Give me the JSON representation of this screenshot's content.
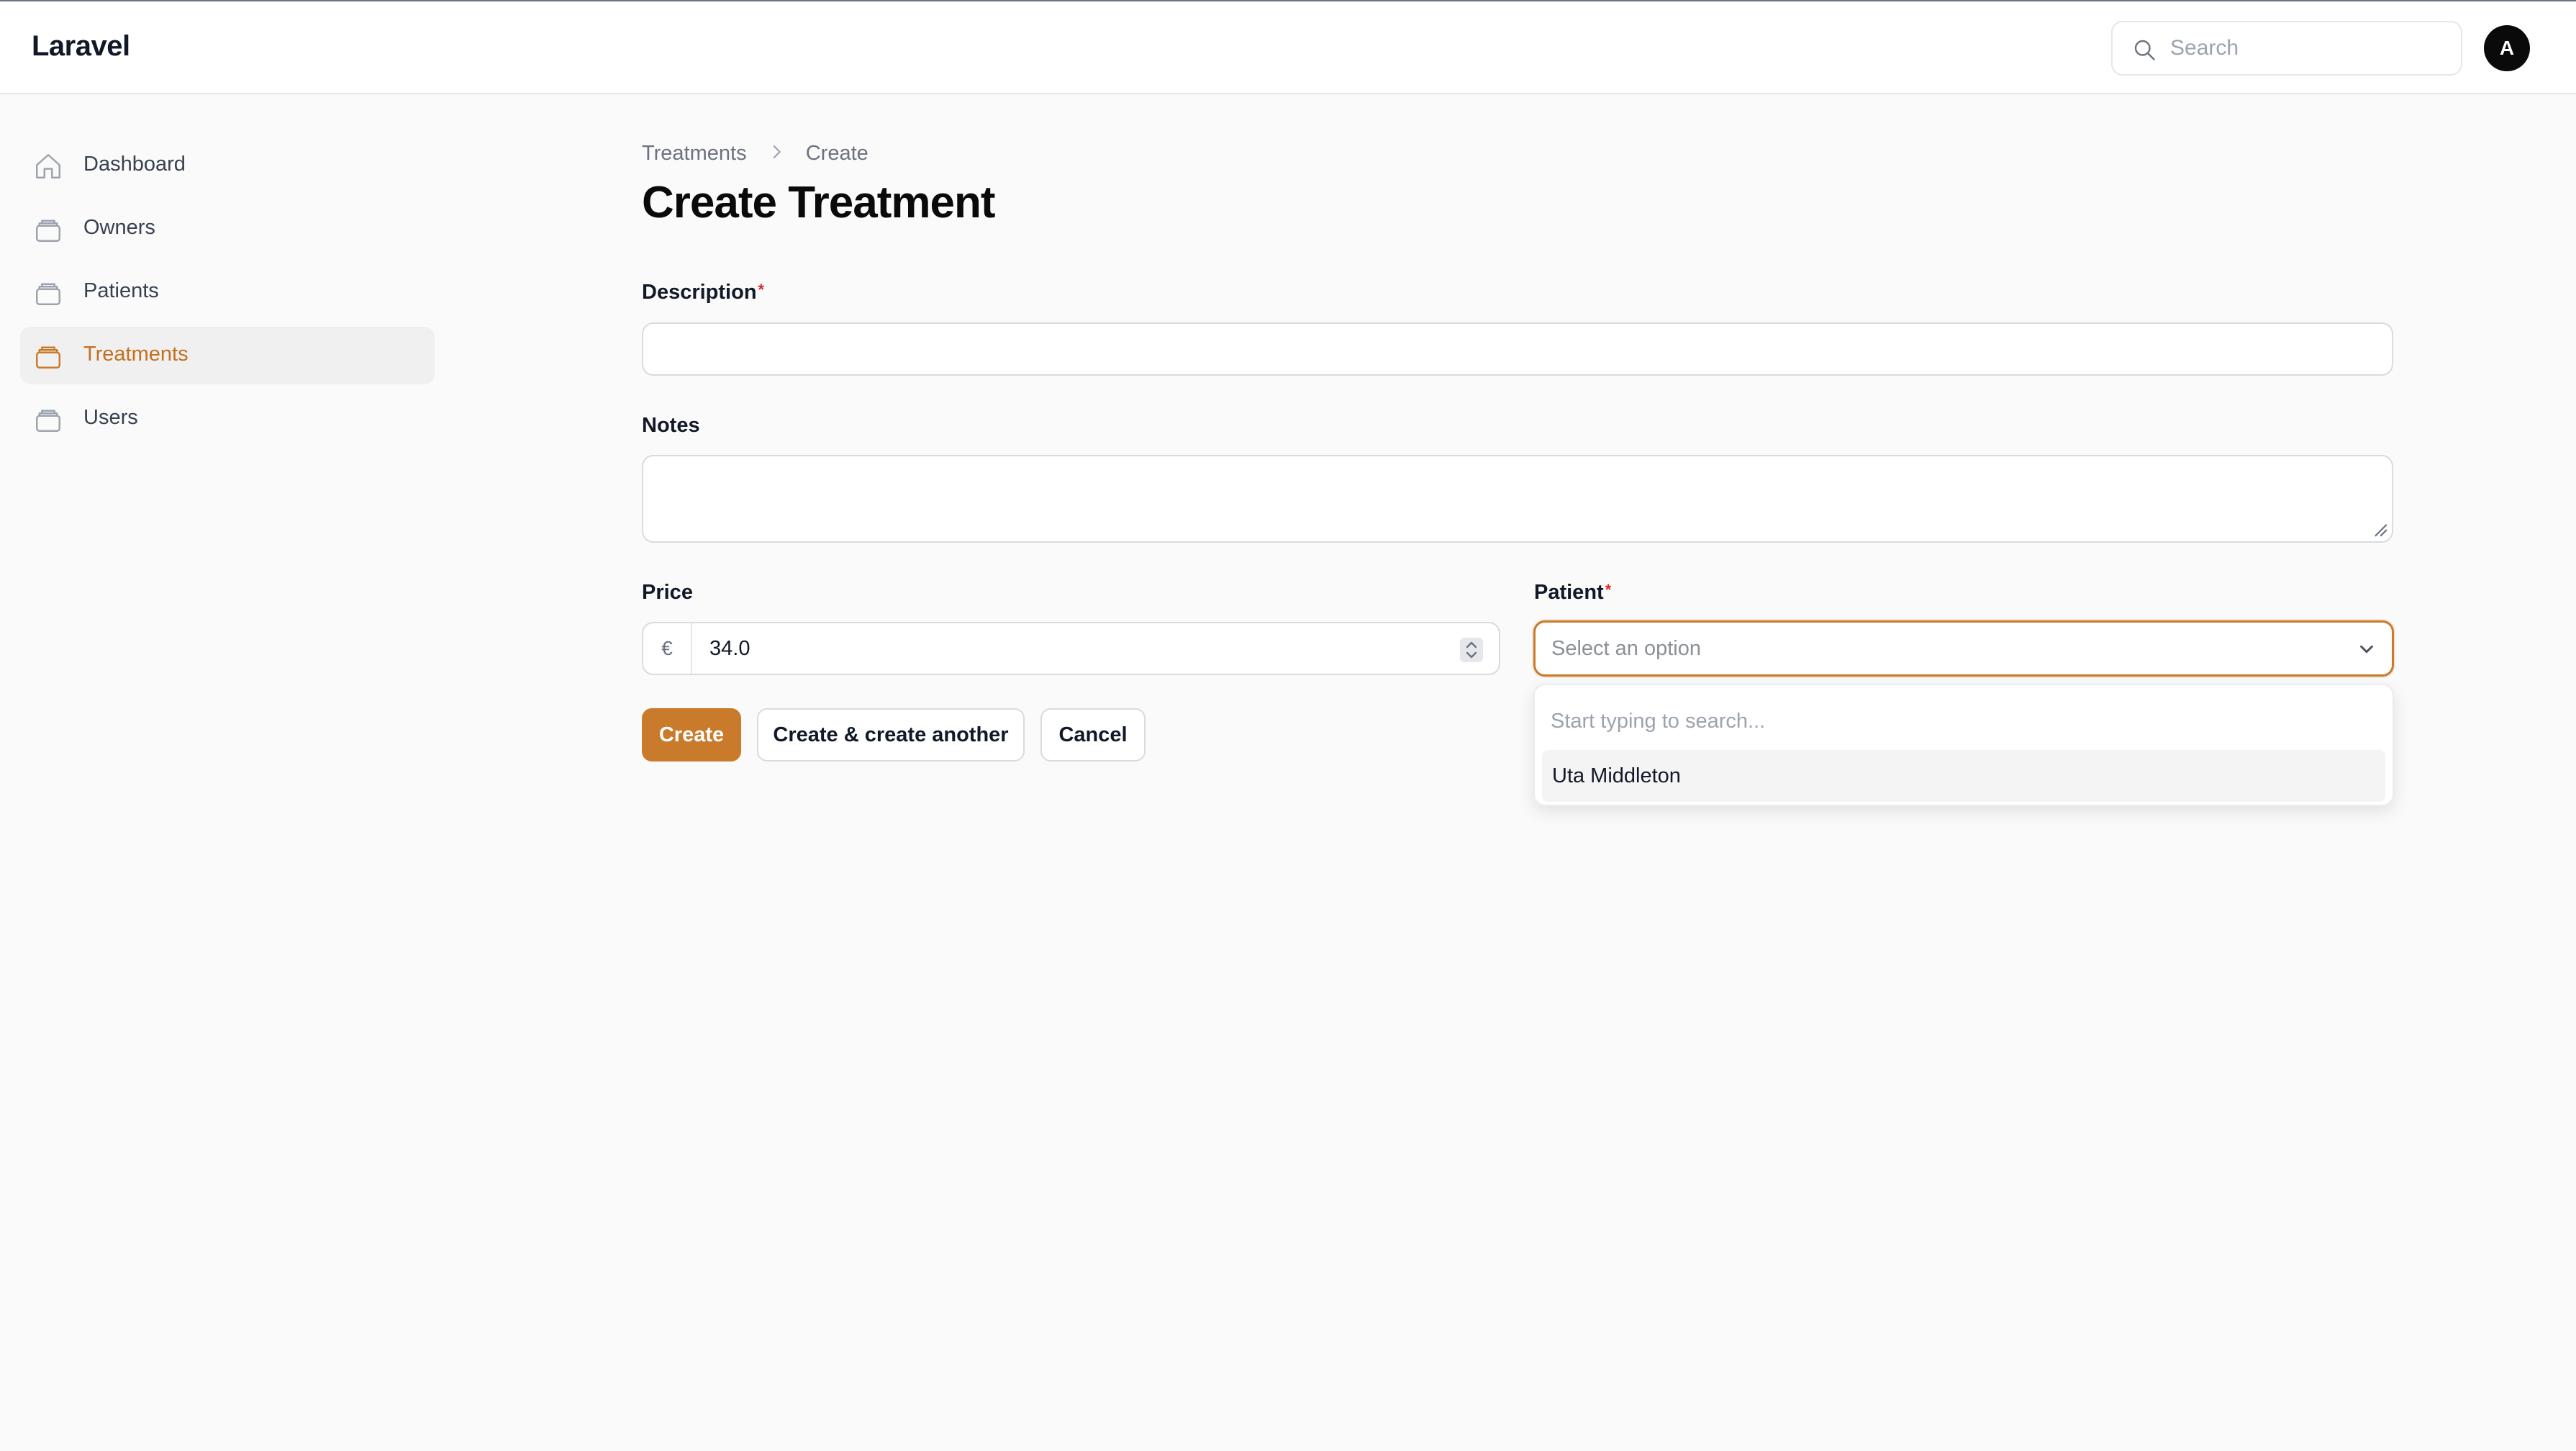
{
  "app": {
    "brand": "Laravel"
  },
  "topbar": {
    "search_placeholder": "Search",
    "avatar_initial": "A"
  },
  "sidebar": {
    "items": [
      {
        "label": "Dashboard",
        "icon": "home-icon",
        "active": false
      },
      {
        "label": "Owners",
        "icon": "rectangle-stack-icon",
        "active": false
      },
      {
        "label": "Patients",
        "icon": "rectangle-stack-icon",
        "active": false
      },
      {
        "label": "Treatments",
        "icon": "rectangle-stack-icon",
        "active": true
      },
      {
        "label": "Users",
        "icon": "rectangle-stack-icon",
        "active": false
      }
    ]
  },
  "breadcrumb": {
    "items": [
      "Treatments",
      "Create"
    ]
  },
  "page": {
    "title": "Create Treatment"
  },
  "form": {
    "description": {
      "label": "Description",
      "required_marker": "*",
      "value": ""
    },
    "notes": {
      "label": "Notes",
      "value": ""
    },
    "price": {
      "label": "Price",
      "prefix": "€",
      "value": "34.0"
    },
    "patient": {
      "label": "Patient",
      "required_marker": "*",
      "placeholder": "Select an option",
      "search_placeholder": "Start typing to search...",
      "options": [
        "Uta Middleton"
      ]
    }
  },
  "actions": {
    "create": "Create",
    "create_another": "Create & create another",
    "cancel": "Cancel"
  },
  "colors": {
    "accent": "#c97a2a",
    "required": "#dc2626",
    "background": "#fafafa"
  }
}
